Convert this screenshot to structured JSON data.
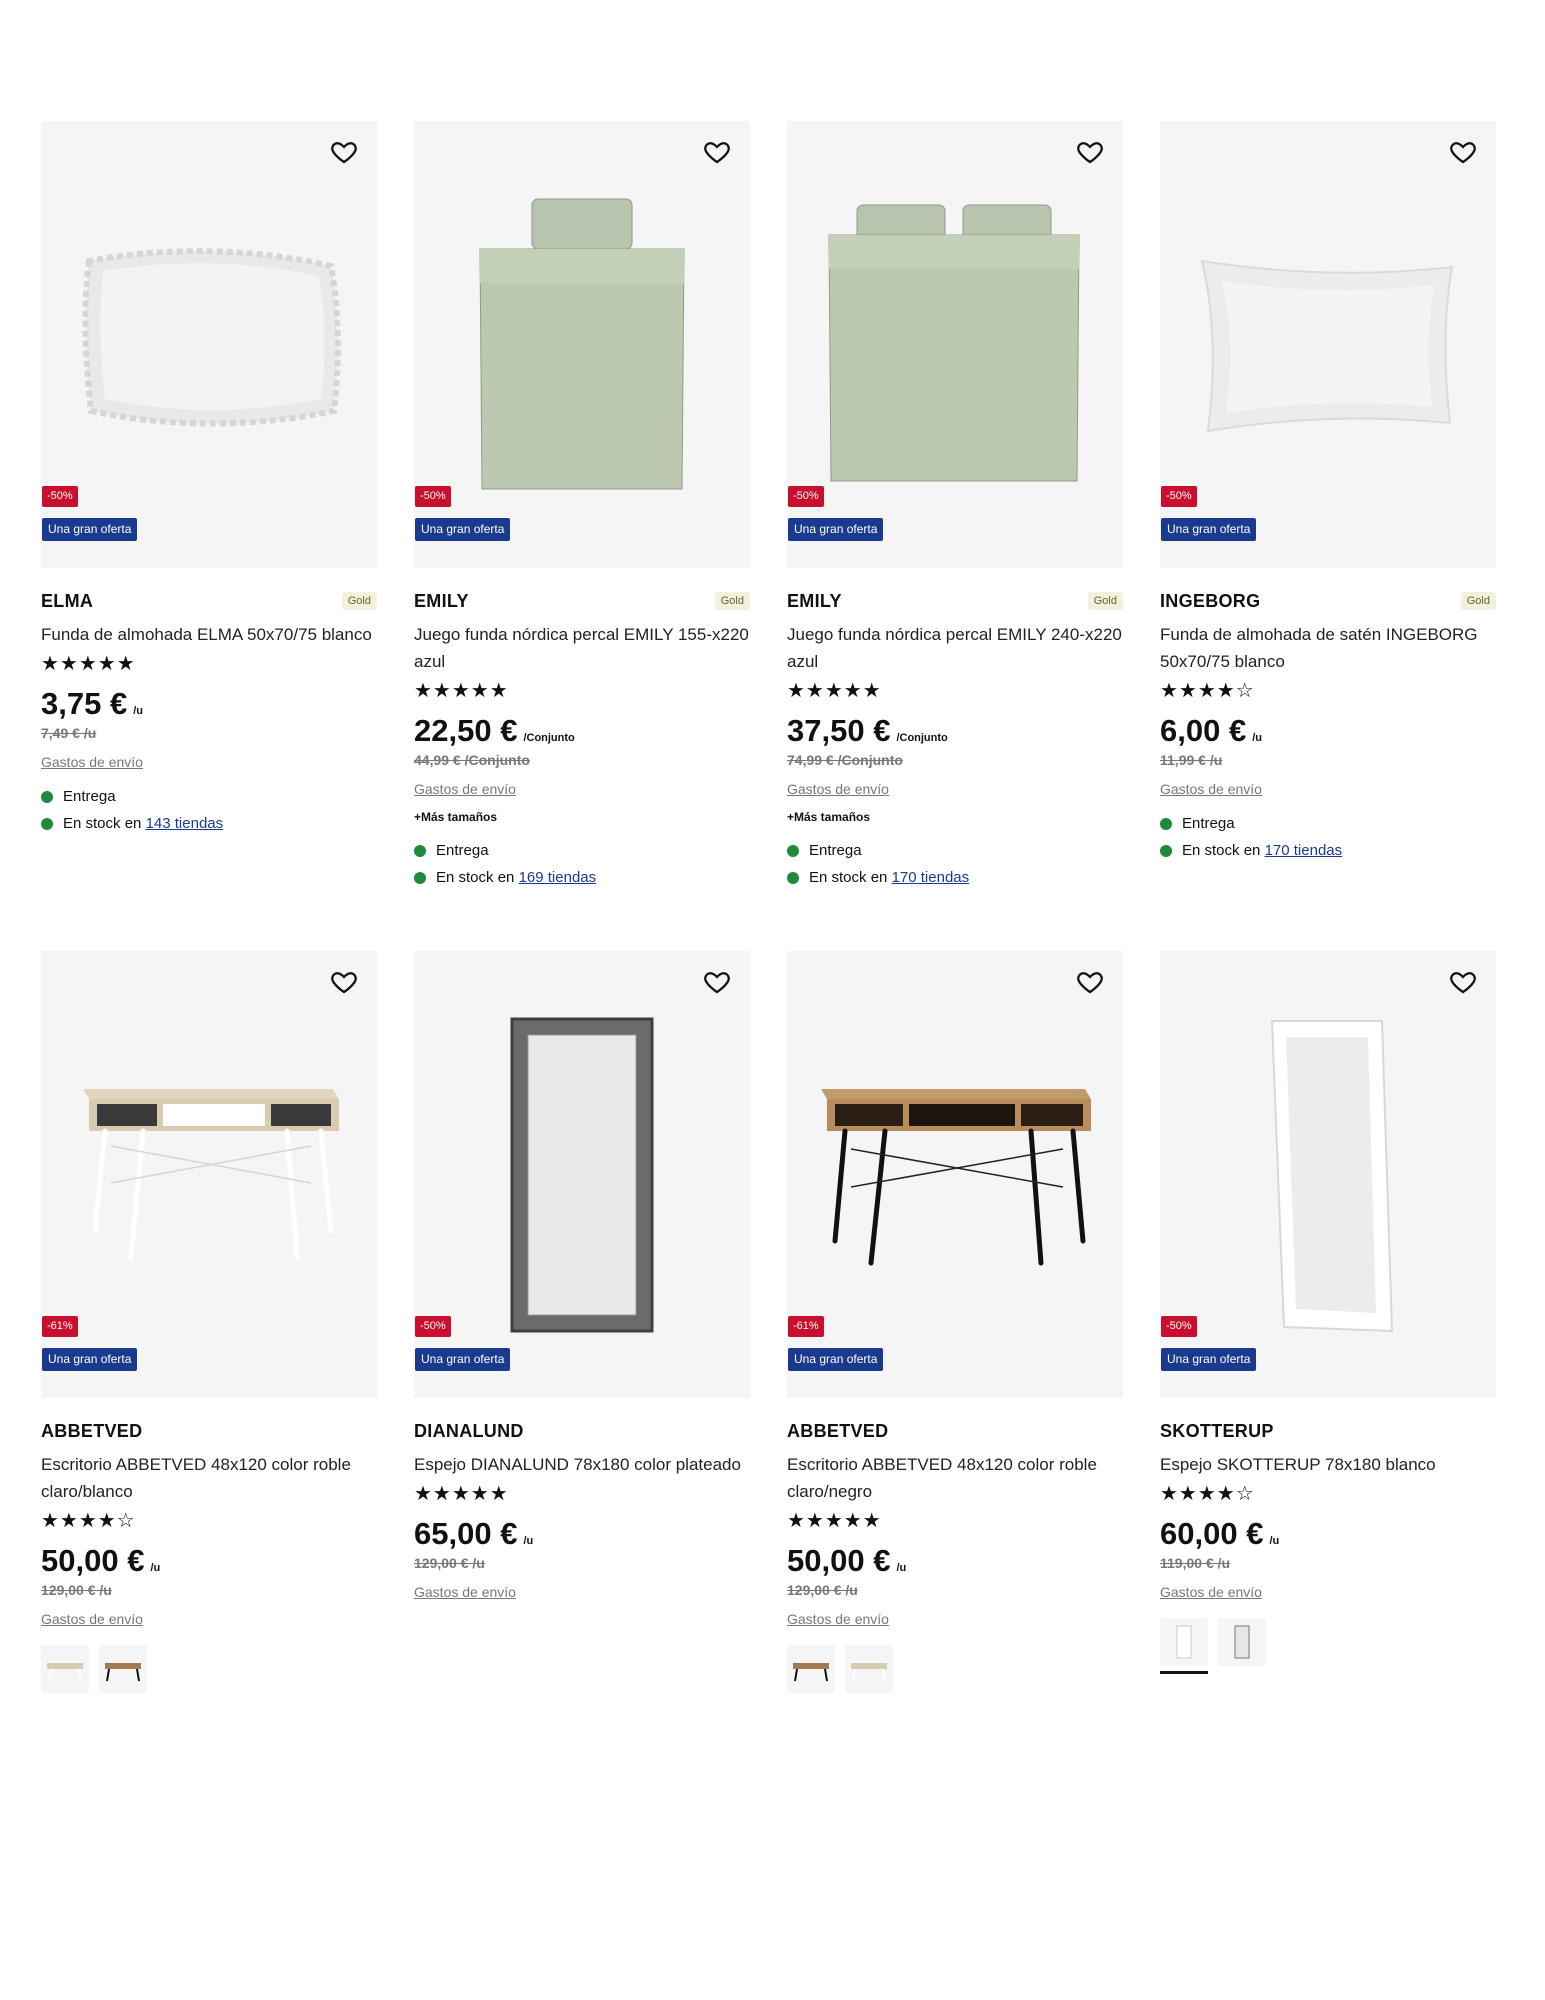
{
  "products": [
    {
      "brand": "ELMA",
      "badge": "Gold",
      "title": "Funda de almohada ELMA 50x70/75 blanco",
      "discount": "-50%",
      "deal": "Una gran oferta",
      "rating": 4.5,
      "rating_display": "★★★★★",
      "price": "3,75 €",
      "unit": "/u",
      "old_price": "7,49 € /u",
      "shipping": "Gastos de envío",
      "availability": {
        "delivery": "Entrega",
        "stock_prefix": "En stock en",
        "stores": "143 tiendas"
      },
      "image": "pillow-ruffle-icon"
    },
    {
      "brand": "EMILY",
      "badge": "Gold",
      "title": "Juego funda nórdica percal EMILY 155-x220 azul",
      "discount": "-50%",
      "deal": "Una gran oferta",
      "rating": 4.5,
      "rating_display": "★★★★★",
      "price": "22,50 €",
      "unit": "/Conjunto",
      "old_price": "44,99 € /Conjunto",
      "shipping": "Gastos de envío",
      "more_sizes": "+Más tamaños",
      "availability": {
        "delivery": "Entrega",
        "stock_prefix": "En stock en",
        "stores": "169 tiendas"
      },
      "image": "duvet-single-icon"
    },
    {
      "brand": "EMILY",
      "badge": "Gold",
      "title": "Juego funda nórdica percal EMILY 240-x220 azul",
      "discount": "-50%",
      "deal": "Una gran oferta",
      "rating": 4.5,
      "rating_display": "★★★★★",
      "price": "37,50 €",
      "unit": "/Conjunto",
      "old_price": "74,99 € /Conjunto",
      "shipping": "Gastos de envío",
      "more_sizes": "+Más tamaños",
      "availability": {
        "delivery": "Entrega",
        "stock_prefix": "En stock en",
        "stores": "170 tiendas"
      },
      "image": "duvet-double-icon"
    },
    {
      "brand": "INGEBORG",
      "badge": "Gold",
      "title": "Funda de almohada de satén INGEBORG 50x70/75 blanco",
      "discount": "-50%",
      "deal": "Una gran oferta",
      "rating": 4,
      "rating_display": "★★★★☆",
      "price": "6,00 €",
      "unit": "/u",
      "old_price": "11,99 € /u",
      "shipping": "Gastos de envío",
      "availability": {
        "delivery": "Entrega",
        "stock_prefix": "En stock en",
        "stores": "170 tiendas"
      },
      "image": "pillow-satin-icon"
    },
    {
      "brand": "ABBETVED",
      "title": "Escritorio ABBETVED 48x120 color roble claro/blanco",
      "discount": "-61%",
      "deal": "Una gran oferta",
      "rating": 4.5,
      "rating_display": "★★★★☆",
      "price": "50,00 €",
      "unit": "/u",
      "old_price": "129,00 € /u",
      "shipping": "Gastos de envío",
      "swatches": [
        "desk-white-swatch",
        "desk-black-swatch"
      ],
      "image": "desk-white-icon"
    },
    {
      "brand": "DIANALUND",
      "title": "Espejo DIANALUND 78x180 color plateado",
      "discount": "-50%",
      "deal": "Una gran oferta",
      "rating": 4.5,
      "rating_display": "★★★★★",
      "price": "65,00 €",
      "unit": "/u",
      "old_price": "129,00 € /u",
      "shipping": "Gastos de envío",
      "image": "mirror-silver-icon"
    },
    {
      "brand": "ABBETVED",
      "title": "Escritorio ABBETVED 48x120 color roble claro/negro",
      "discount": "-61%",
      "deal": "Una gran oferta",
      "rating": 5,
      "rating_display": "★★★★★",
      "price": "50,00 €",
      "unit": "/u",
      "old_price": "129,00 € /u",
      "shipping": "Gastos de envío",
      "swatches": [
        "desk-black-swatch",
        "desk-white-swatch"
      ],
      "image": "desk-black-icon"
    },
    {
      "brand": "SKOTTERUP",
      "title": "Espejo SKOTTERUP 78x180 blanco",
      "discount": "-50%",
      "deal": "Una gran oferta",
      "rating": 4,
      "rating_display": "★★★★☆",
      "price": "60,00 €",
      "unit": "/u",
      "old_price": "119,00 € /u",
      "shipping": "Gastos de envío",
      "swatches": [
        "mirror-white-swatch",
        "mirror-silver-swatch"
      ],
      "image": "mirror-white-icon"
    }
  ],
  "colors": {
    "discount": "#c8102e",
    "deal": "#1a3a8f",
    "stock_dot": "#1f8a3a",
    "card_bg": "#f5f5f5"
  }
}
